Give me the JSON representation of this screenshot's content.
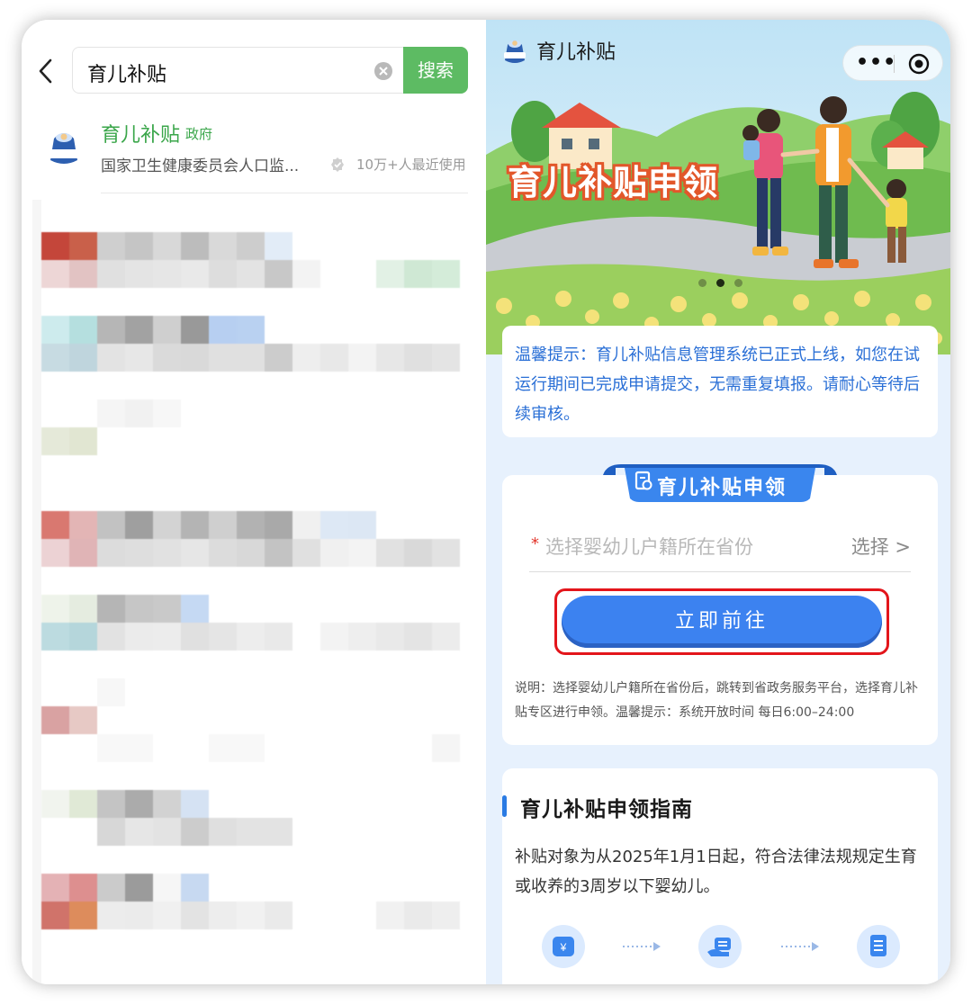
{
  "left_pane": {
    "search": {
      "query": "育儿补贴",
      "button_label": "搜索"
    },
    "result": {
      "title": "育儿补贴",
      "tag": "政府",
      "description": "国家卫生健康委员会人口监...",
      "usage": "10万+人最近使用",
      "logo_text": "育儿补贴"
    }
  },
  "mini_program": {
    "brand_name": "育儿补贴",
    "capsule": {
      "more_label": "•••"
    },
    "banner": {
      "title": "育儿补贴申领",
      "active_slide": 2,
      "slide_count": 3
    },
    "notice": "温馨提示：育儿补贴信息管理系统已正式上线，如您在试运行期间已完成申请提交，无需重复填报。请耐心等待后续审核。",
    "apply": {
      "ribbon_title": "育儿补贴申领",
      "required_mark": "*",
      "province_placeholder": "选择婴幼儿户籍所在省份",
      "select_action": "选择 >",
      "go_button": "立即前往",
      "note": "说明：选择婴幼儿户籍所在省份后，跳转到省政务服务平台，选择育儿补贴专区进行申领。温馨提示：系统开放时间 每日6:00–24:00"
    },
    "guide": {
      "title": "育儿补贴申领指南",
      "body": "补贴对象为从2025年1月1日起，符合法律法规规定生育或收养的3周岁以下婴幼儿。",
      "steps": [
        {
          "icon": "yuan-card-icon"
        },
        {
          "icon": "hand-card-icon"
        },
        {
          "icon": "document-icon"
        }
      ]
    }
  },
  "colors": {
    "search_green": "#5dbb63",
    "result_green": "#3aa64a",
    "primary_blue": "#3c82f0",
    "notice_blue": "#2a6fd6",
    "highlight_red": "#e3151b",
    "page_bg": "#e7f1fd"
  }
}
